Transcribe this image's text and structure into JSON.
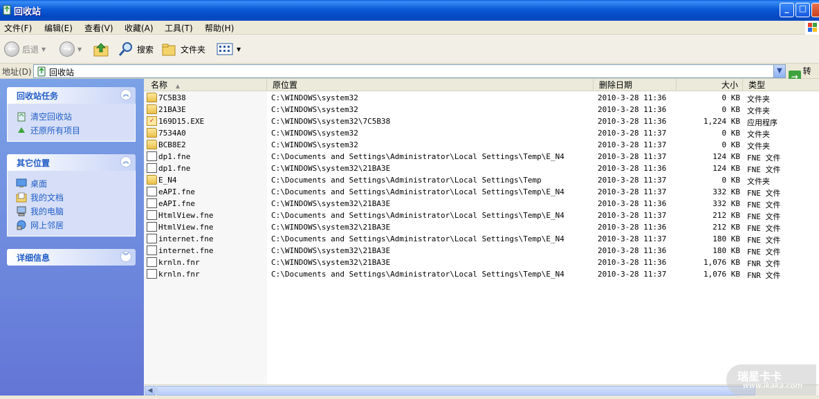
{
  "window": {
    "title": "回收站"
  },
  "menu": [
    "文件(F)",
    "编辑(E)",
    "查看(V)",
    "收藏(A)",
    "工具(T)",
    "帮助(H)"
  ],
  "toolbar": {
    "back": "后退",
    "search": "搜索",
    "folders": "文件夹"
  },
  "address": {
    "label": "地址(D)",
    "value": "回收站",
    "go": "转到"
  },
  "tasks": {
    "recycle": {
      "title": "回收站任务",
      "items": [
        "清空回收站",
        "还原所有项目"
      ]
    },
    "other": {
      "title": "其它位置",
      "items": [
        "桌面",
        "我的文档",
        "我的电脑",
        "网上邻居"
      ]
    },
    "details": {
      "title": "详细信息"
    }
  },
  "columns": {
    "name": "名称",
    "location": "原位置",
    "deleted": "删除日期",
    "size": "大小",
    "type": "类型"
  },
  "rows": [
    {
      "name": "7C5B38",
      "loc": "C:\\WINDOWS\\system32",
      "date": "2010-3-28 11:36",
      "size": "0 KB",
      "type": "文件夹",
      "icon": "folder"
    },
    {
      "name": "21BA3E",
      "loc": "C:\\WINDOWS\\system32",
      "date": "2010-3-28 11:36",
      "size": "0 KB",
      "type": "文件夹",
      "icon": "folder"
    },
    {
      "name": "169D15.EXE",
      "loc": "C:\\WINDOWS\\system32\\7C5B38",
      "date": "2010-3-28 11:36",
      "size": "1,224 KB",
      "type": "应用程序",
      "icon": "exe"
    },
    {
      "name": "7534A0",
      "loc": "C:\\WINDOWS\\system32",
      "date": "2010-3-28 11:37",
      "size": "0 KB",
      "type": "文件夹",
      "icon": "folder"
    },
    {
      "name": "BCB8E2",
      "loc": "C:\\WINDOWS\\system32",
      "date": "2010-3-28 11:37",
      "size": "0 KB",
      "type": "文件夹",
      "icon": "folder"
    },
    {
      "name": "dp1.fne",
      "loc": "C:\\Documents and Settings\\Administrator\\Local Settings\\Temp\\E_N4",
      "date": "2010-3-28 11:37",
      "size": "124 KB",
      "type": "FNE 文件",
      "icon": "doc"
    },
    {
      "name": "dp1.fne",
      "loc": "C:\\WINDOWS\\system32\\21BA3E",
      "date": "2010-3-28 11:36",
      "size": "124 KB",
      "type": "FNE 文件",
      "icon": "doc"
    },
    {
      "name": "E_N4",
      "loc": "C:\\Documents and Settings\\Administrator\\Local Settings\\Temp",
      "date": "2010-3-28 11:37",
      "size": "0 KB",
      "type": "文件夹",
      "icon": "folder"
    },
    {
      "name": "eAPI.fne",
      "loc": "C:\\Documents and Settings\\Administrator\\Local Settings\\Temp\\E_N4",
      "date": "2010-3-28 11:37",
      "size": "332 KB",
      "type": "FNE 文件",
      "icon": "doc"
    },
    {
      "name": "eAPI.fne",
      "loc": "C:\\WINDOWS\\system32\\21BA3E",
      "date": "2010-3-28 11:36",
      "size": "332 KB",
      "type": "FNE 文件",
      "icon": "doc"
    },
    {
      "name": "HtmlView.fne",
      "loc": "C:\\Documents and Settings\\Administrator\\Local Settings\\Temp\\E_N4",
      "date": "2010-3-28 11:37",
      "size": "212 KB",
      "type": "FNE 文件",
      "icon": "doc"
    },
    {
      "name": "HtmlView.fne",
      "loc": "C:\\WINDOWS\\system32\\21BA3E",
      "date": "2010-3-28 11:36",
      "size": "212 KB",
      "type": "FNE 文件",
      "icon": "doc"
    },
    {
      "name": "internet.fne",
      "loc": "C:\\Documents and Settings\\Administrator\\Local Settings\\Temp\\E_N4",
      "date": "2010-3-28 11:37",
      "size": "180 KB",
      "type": "FNE 文件",
      "icon": "doc"
    },
    {
      "name": "internet.fne",
      "loc": "C:\\WINDOWS\\system32\\21BA3E",
      "date": "2010-3-28 11:36",
      "size": "180 KB",
      "type": "FNE 文件",
      "icon": "doc"
    },
    {
      "name": "krnln.fnr",
      "loc": "C:\\WINDOWS\\system32\\21BA3E",
      "date": "2010-3-28 11:36",
      "size": "1,076 KB",
      "type": "FNR 文件",
      "icon": "doc"
    },
    {
      "name": "krnln.fnr",
      "loc": "C:\\Documents and Settings\\Administrator\\Local Settings\\Temp\\E_N4",
      "date": "2010-3-28 11:37",
      "size": "1,076 KB",
      "type": "FNR 文件",
      "icon": "doc"
    }
  ],
  "watermark": {
    "line1": "瑞星卡卡",
    "line2": "www.ikaka.com"
  }
}
